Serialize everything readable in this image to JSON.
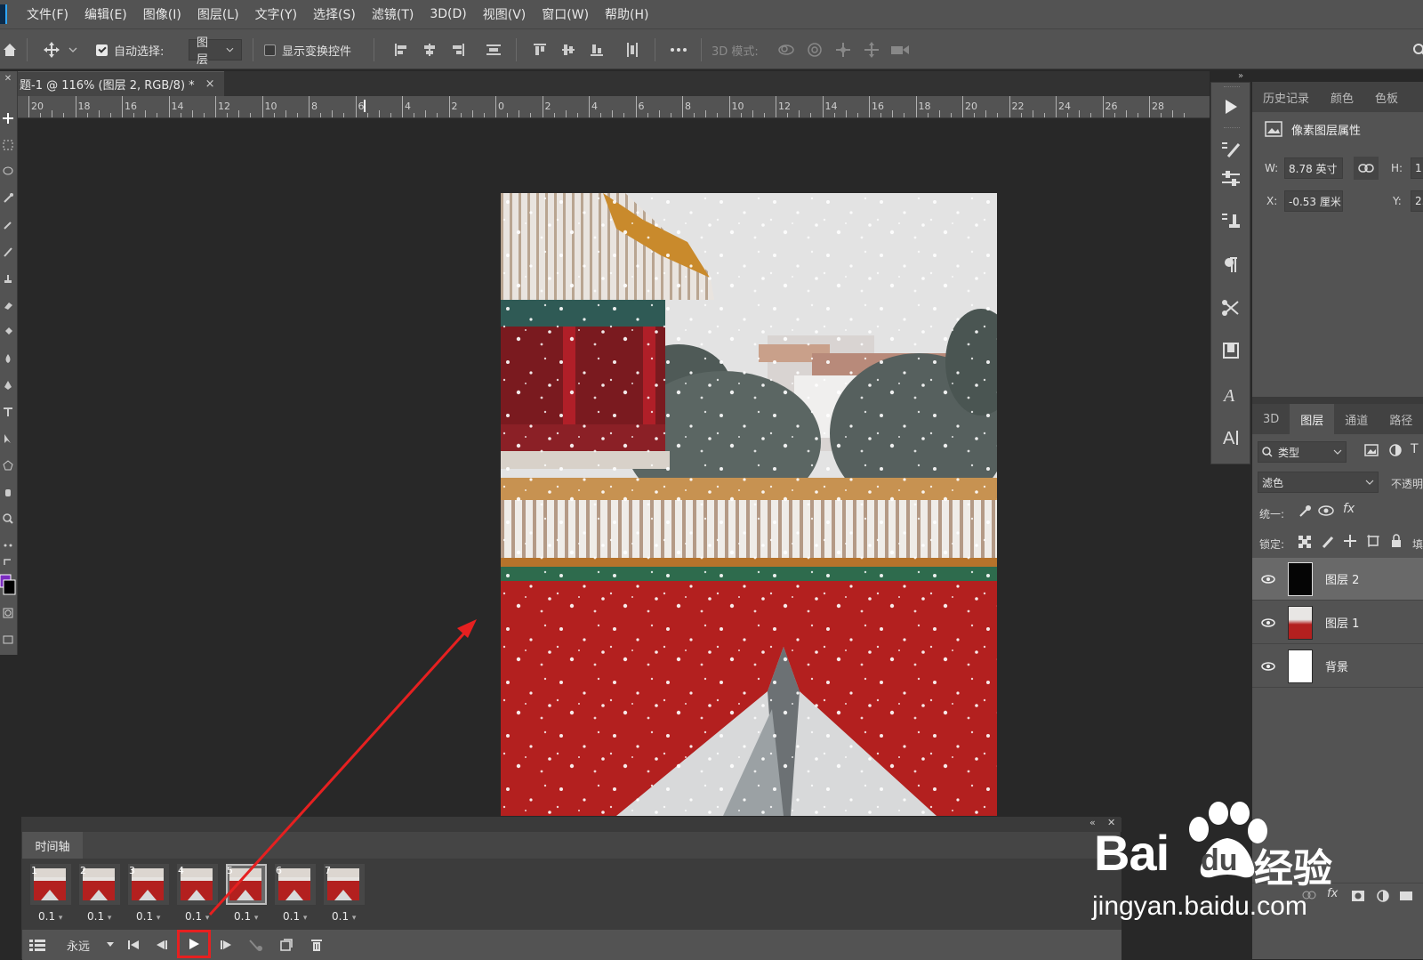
{
  "menu": [
    "文件(F)",
    "编辑(E)",
    "图像(I)",
    "图层(L)",
    "文字(Y)",
    "选择(S)",
    "滤镜(T)",
    "3D(D)",
    "视图(V)",
    "窗口(W)",
    "帮助(H)"
  ],
  "options": {
    "auto_select_label": "自动选择:",
    "auto_select_value": "图层",
    "show_transform_label": "显示变换控件",
    "mode_3d_label": "3D 模式:"
  },
  "document": {
    "tab_title": "题-1 @ 116% (图层 2, RGB/8) *",
    "close": "×"
  },
  "ruler": {
    "labels": [
      "20",
      "18",
      "16",
      "14",
      "12",
      "10",
      "8",
      "6",
      "4",
      "2",
      "0",
      "2",
      "4",
      "6",
      "8",
      "10",
      "12",
      "14",
      "16",
      "18",
      "20",
      "22",
      "24",
      "26",
      "28"
    ]
  },
  "right_panel": {
    "top_tabs": [
      "历史记录",
      "颜色",
      "色板"
    ],
    "properties_title": "像素图层属性",
    "w_label": "W:",
    "w_value": "8.78 英寸",
    "h_label": "H:",
    "h_value": "1",
    "x_label": "X:",
    "x_value": "-0.53 厘米",
    "y_label": "Y:",
    "y_value": "2.",
    "layer_tabs": [
      "3D",
      "图层",
      "通道",
      "路径"
    ],
    "filter_value": "类型",
    "blend_mode": "滤色",
    "opacity_label": "不透明",
    "unify_label": "统一:",
    "lock_label": "锁定:",
    "fill_label": "填",
    "layers": [
      {
        "name": "图层 2",
        "selected": true
      },
      {
        "name": "图层 1",
        "selected": false
      },
      {
        "name": "背景",
        "selected": false
      }
    ]
  },
  "timeline": {
    "title": "时间轴",
    "loop_label": "永远",
    "frames": [
      {
        "num": "1",
        "delay": "0.1"
      },
      {
        "num": "2",
        "delay": "0.1"
      },
      {
        "num": "3",
        "delay": "0.1"
      },
      {
        "num": "4",
        "delay": "0.1"
      },
      {
        "num": "5",
        "delay": "0.1"
      },
      {
        "num": "6",
        "delay": "0.1"
      },
      {
        "num": "7",
        "delay": "0.1"
      }
    ],
    "selected_frame": 5,
    "delay_arrow": "▾"
  },
  "watermark": {
    "brand": "Bai",
    "brand_suffix": "du",
    "site_word": "经验",
    "url": "jingyan.baidu.com"
  },
  "colors": {
    "annotation_red": "#e62020",
    "panel_bg": "#535353",
    "canvas_bg": "#282828"
  }
}
